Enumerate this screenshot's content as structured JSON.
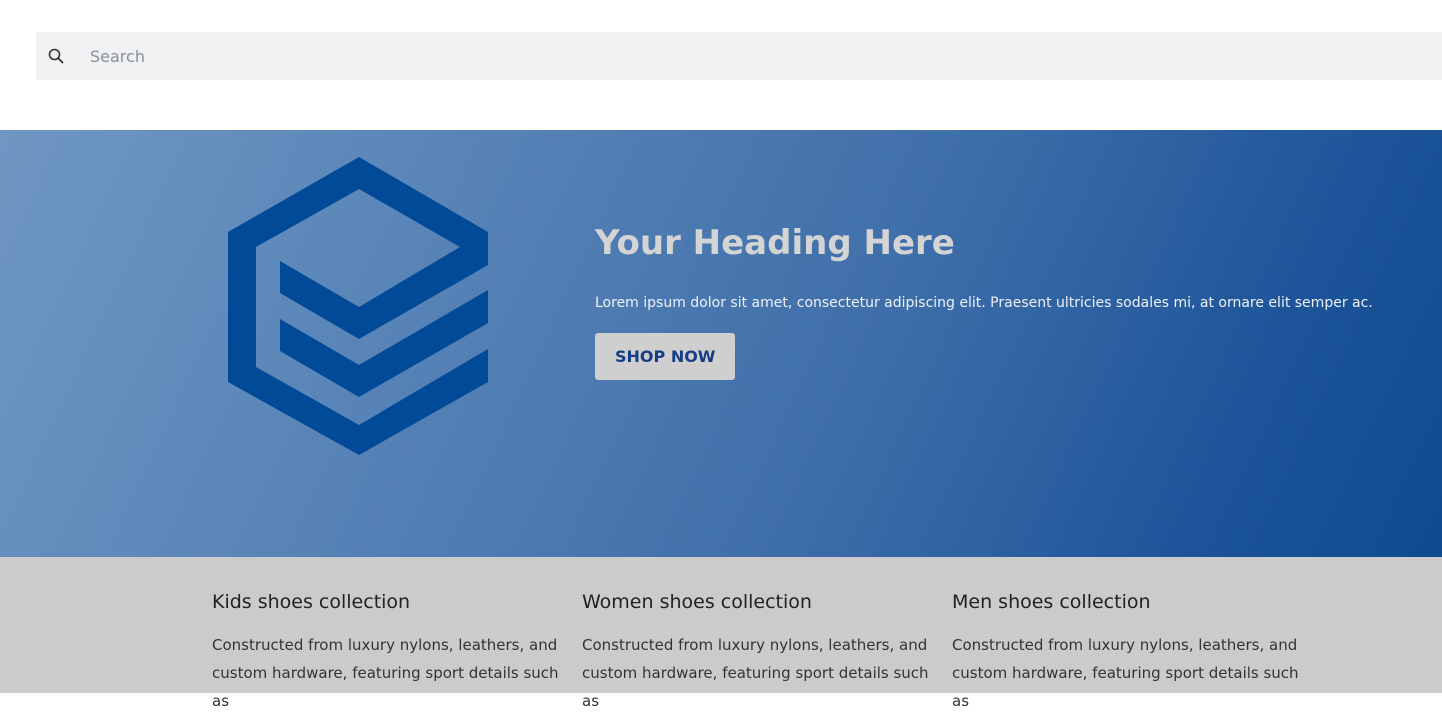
{
  "search": {
    "placeholder": "Search",
    "icon": "search-icon"
  },
  "hero": {
    "logo_icon": "hexagon-logo-icon",
    "heading": "Your Heading Here",
    "text": "Lorem ipsum dolor sit amet, consectetur adipiscing elit. Praesent ultricies sodales mi, at ornare elit semper ac.",
    "button_label": "SHOP NOW",
    "colors": {
      "gradient_start": "#7097c2",
      "gradient_end": "#0f4a90",
      "logo": "#004a97",
      "button_text": "#163e84"
    }
  },
  "collections": [
    {
      "title": "Kids shoes collection",
      "text": "Constructed from luxury nylons, leathers, and custom hardware, featuring sport details such as"
    },
    {
      "title": "Women shoes collection",
      "text": "Constructed from luxury nylons, leathers, and custom hardware, featuring sport details such as"
    },
    {
      "title": "Men shoes collection",
      "text": "Constructed from luxury nylons, leathers, and custom hardware, featuring sport details such as"
    }
  ]
}
